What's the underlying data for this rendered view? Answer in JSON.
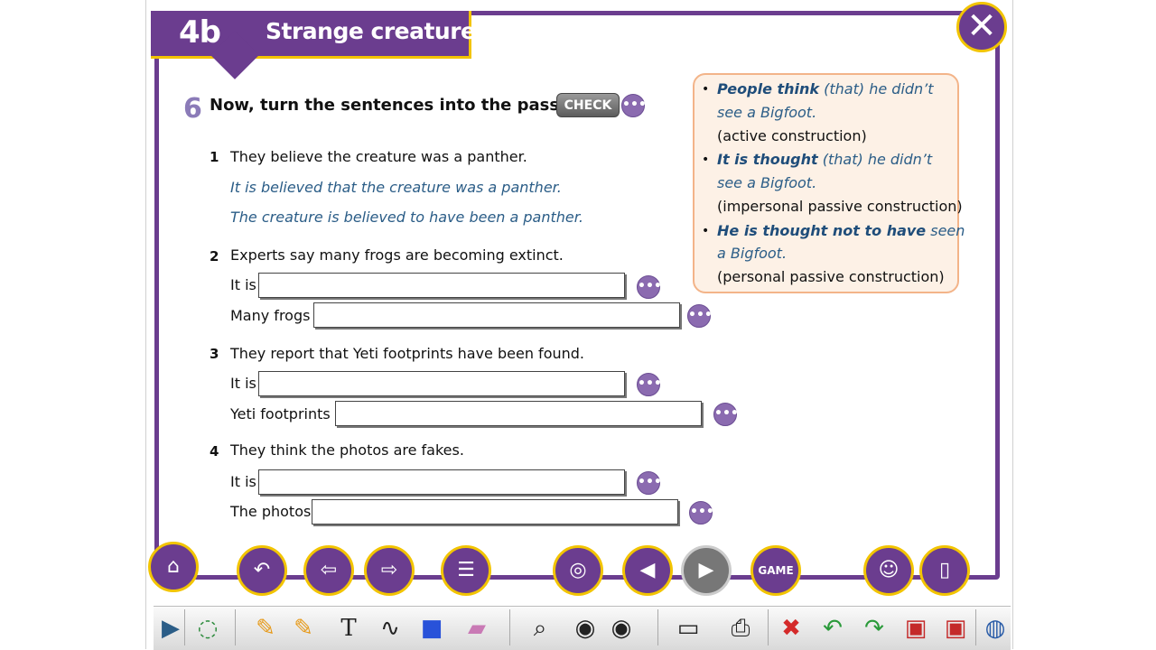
{
  "header": {
    "unit": "4b",
    "title": "Strange creatures"
  },
  "exercise": {
    "number": "6",
    "instruction": "Now, turn the sentences into the passive.",
    "check_label": "CHECK",
    "more_label": "•••"
  },
  "items": [
    {
      "num": "1",
      "sentence": "They believe the creature was a panther.",
      "answers": [
        "It is believed that the creature was a panther.",
        "The creature is believed to have been a panther."
      ]
    },
    {
      "num": "2",
      "sentence": "Experts say many frogs are becoming extinct.",
      "prompts": [
        "It is",
        "Many frogs"
      ]
    },
    {
      "num": "3",
      "sentence": "They report that Yeti footprints have been found.",
      "prompts": [
        "It is",
        "Yeti footprints"
      ]
    },
    {
      "num": "4",
      "sentence": "They think the photos are fakes.",
      "prompts": [
        "It is",
        "The photos"
      ]
    }
  ],
  "note": {
    "b1_em": "People think",
    "b1_rest": " (that) he didn’t",
    "b1_line2": "see a Bigfoot.",
    "b1_type": "(active construction)",
    "b2_em": "It is thought",
    "b2_rest": " (that) he didn’t",
    "b2_line2": "see a Bigfoot.",
    "b2_type": "(impersonal passive construction)",
    "b3_em": "He is thought not to have",
    "b3_rest": " seen",
    "b3_line2": "a Bigfoot.",
    "b3_type": "(personal passive construction)"
  },
  "nav": {
    "game_label": "GAME"
  },
  "icons": {
    "close": "close-icon",
    "home": "home-icon",
    "back": "undo-icon",
    "prev": "arrow-left-icon",
    "next": "arrow-right-icon",
    "menu": "list-icon",
    "audio": "audio-cd-icon",
    "page_prev": "page-prev-icon",
    "page_next": "page-next-icon",
    "owl": "owl-icon",
    "book": "book-icon"
  },
  "colors": {
    "brand_purple": "#6b3d8f",
    "accent_yellow": "#f2c400",
    "answer_blue": "#2b5d87",
    "note_bg": "#fdf1e6",
    "note_border": "#f3b489"
  }
}
